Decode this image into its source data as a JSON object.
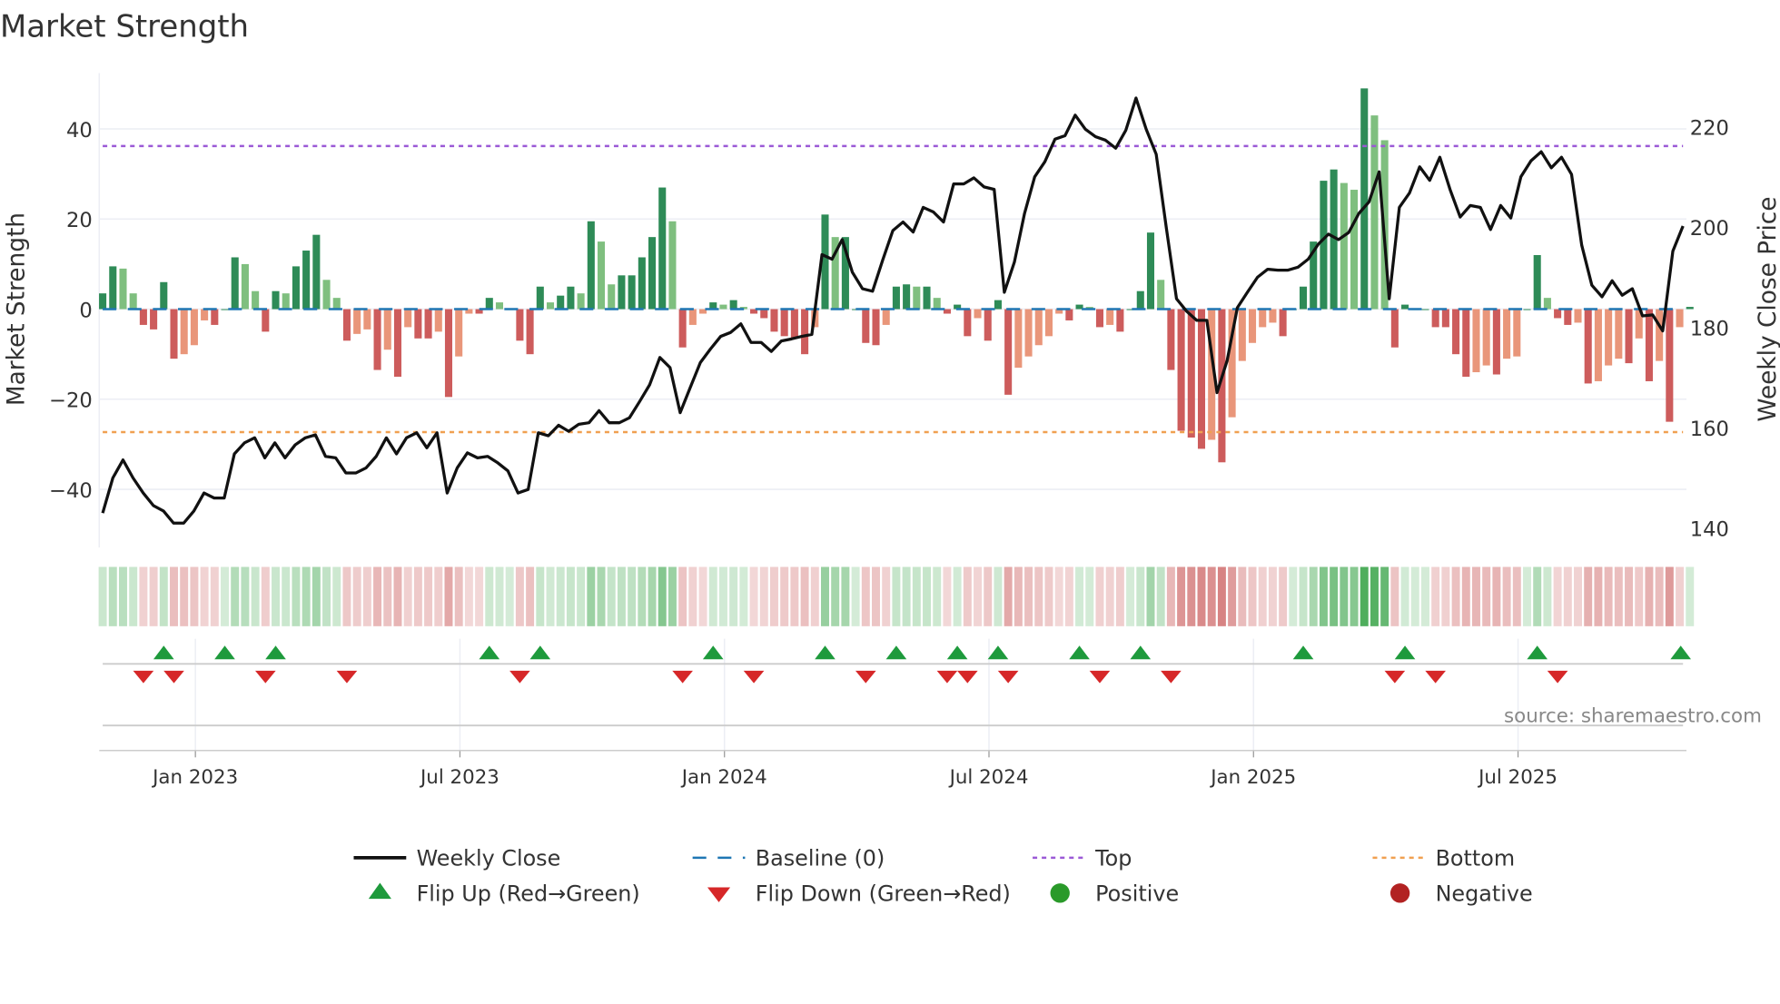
{
  "chart_data": {
    "type": "bar",
    "title": "Market Strength",
    "ylabel": "Market Strength",
    "y2label": "Weekly Close Price",
    "ylim": [
      -52,
      52
    ],
    "y2lim": [
      132,
      228
    ],
    "yticks": [
      40,
      20,
      0,
      -20,
      -40
    ],
    "y2ticks": [
      220,
      200,
      180,
      160,
      140
    ],
    "ytick_labels": [
      "40",
      "20",
      "0",
      "−20",
      "−40"
    ],
    "y2tick_labels": [
      "220",
      "200",
      "180",
      "160",
      "140"
    ],
    "xticks": [
      {
        "week": 9,
        "label": "Jan 2023"
      },
      {
        "week": 35,
        "label": "Jul 2023"
      },
      {
        "week": 61,
        "label": "Jan 2024"
      },
      {
        "week": 87,
        "label": "Jul 2024"
      },
      {
        "week": 113,
        "label": "Jan 2025"
      },
      {
        "week": 139,
        "label": "Jul 2025"
      }
    ],
    "top_level": 36.2,
    "bottom_level": -27.3,
    "baseline": 0,
    "strength": [
      3.5,
      9.5,
      9,
      3.5,
      -3.5,
      -4.5,
      6,
      -11,
      -10,
      -8,
      -2.5,
      -3.5,
      0,
      11.5,
      10,
      4,
      -5,
      4,
      3.5,
      9.5,
      13,
      16.5,
      6.5,
      2.5,
      -7,
      -5.5,
      -4.5,
      -13.5,
      -9,
      -15,
      -4,
      -6.5,
      -6.5,
      -5,
      -19.5,
      -10.5,
      -1,
      -1,
      2.5,
      1.5,
      0,
      -7,
      -10,
      5,
      1.5,
      3,
      5,
      3.5,
      19.5,
      15,
      5.5,
      7.5,
      7.5,
      11.5,
      16,
      27,
      19.5,
      -8.5,
      -3.5,
      -1,
      1.5,
      1,
      2,
      0.5,
      -1,
      -2,
      -5,
      -6,
      -6.5,
      -10,
      -4,
      21,
      16,
      16,
      0,
      -7.5,
      -8,
      -3.5,
      5,
      5.5,
      5,
      5,
      2.5,
      -1,
      1,
      -6,
      -2,
      -7,
      2,
      -19,
      -13,
      -10.5,
      -8,
      -6,
      -1,
      -2.5,
      1,
      0.5,
      -4,
      -3.5,
      -5,
      0,
      4,
      17,
      6.5,
      -13.5,
      -27,
      -28.5,
      -31,
      -29,
      -34,
      -24,
      -11.5,
      -7.5,
      -4,
      -3,
      -6,
      0,
      5,
      15,
      28.5,
      31,
      28,
      26.5,
      49,
      43,
      37.5,
      -8.5,
      1,
      0,
      0,
      -4,
      -4,
      -10,
      -15,
      -14,
      -12.5,
      -14.5,
      -11,
      -10.5,
      0,
      12,
      2.5,
      -2,
      -3.5,
      -3,
      -16.5,
      -16,
      -12.5,
      -11,
      -12,
      -6.5,
      -16,
      -11.5,
      -25,
      -4,
      0.5
    ],
    "weekly_close": [
      143,
      150,
      153.6,
      150,
      147,
      144.5,
      143.4,
      141,
      141,
      143.4,
      147,
      146,
      146,
      154.8,
      157,
      158,
      154,
      157,
      154,
      156.6,
      158,
      158.6,
      154.3,
      154,
      151,
      151,
      152,
      154.3,
      158,
      154.8,
      158,
      159,
      156,
      159,
      147,
      152,
      155,
      154,
      154.3,
      153,
      151.4,
      147,
      147.7,
      159,
      158.4,
      160.5,
      159.3,
      160.7,
      161,
      163.4,
      161,
      161,
      162,
      165.2,
      168.6,
      174,
      172,
      163,
      168,
      173,
      175.7,
      178.2,
      179,
      180.7,
      177,
      177,
      175.2,
      177.3,
      177.7,
      178.2,
      178.6,
      194.5,
      193.6,
      197.5,
      191,
      187.7,
      187.2,
      193.4,
      199.3,
      201,
      199,
      203.9,
      203,
      201,
      208.6,
      208.6,
      209.8,
      208,
      207.5,
      187,
      193,
      202.7,
      210,
      213,
      217.5,
      218.2,
      222.3,
      219.5,
      218,
      217.3,
      215.7,
      219.3,
      225.7,
      219.5,
      214.5,
      199.8,
      185.7,
      183.2,
      181.4,
      181.4,
      167,
      173.4,
      183.9,
      187,
      190,
      191.6,
      191.4,
      191.4,
      192,
      193.6,
      196.6,
      198.6,
      197.5,
      198.9,
      202.7,
      205,
      211,
      185.7,
      203.9,
      206.8,
      212,
      209.3,
      213.9,
      207.5,
      202,
      204.3,
      203.9,
      199.5,
      204.3,
      201.8,
      210,
      213.2,
      215,
      211.8,
      213.9,
      210.5,
      196.4,
      188.4,
      186.1,
      189.3,
      186.4,
      187.7,
      182.3,
      182.5,
      179.3,
      195.2,
      200.2
    ],
    "flip_up_weeks": [
      6,
      12,
      17,
      38,
      43,
      60,
      71,
      78,
      84,
      88,
      96,
      102,
      118,
      128,
      141,
      156
    ],
    "flip_down_weeks": [
      4,
      7,
      16,
      24,
      41,
      57,
      64,
      75,
      83,
      85,
      89,
      98,
      105,
      127,
      131,
      143
    ],
    "colors": {
      "pos_strong": "#2e8b57",
      "pos_weak": "#7fbf7f",
      "neg_strong": "#cd5c5c",
      "neg_weak": "#e9967a",
      "close": "#111111",
      "baseline": "#1f77b4",
      "top": "#9b59d6",
      "bottom": "#f0a050",
      "flip_up": "#1e9a3c",
      "flip_down": "#d62728",
      "positive": "#2a9a2a",
      "negative": "#b22222"
    },
    "legend": [
      {
        "label": "Weekly Close",
        "kind": "line"
      },
      {
        "label": "Baseline (0)",
        "kind": "dash"
      },
      {
        "label": "Top",
        "kind": "dot-top"
      },
      {
        "label": "Bottom",
        "kind": "dot-bottom"
      },
      {
        "label": "Flip Up (Red→Green)",
        "kind": "tri-up"
      },
      {
        "label": "Flip Down (Green→Red)",
        "kind": "tri-down"
      },
      {
        "label": "Positive",
        "kind": "dot-pos"
      },
      {
        "label": "Negative",
        "kind": "dot-neg"
      }
    ],
    "legend_placement": "bottom-center",
    "source": "source: sharemaestro.com"
  }
}
